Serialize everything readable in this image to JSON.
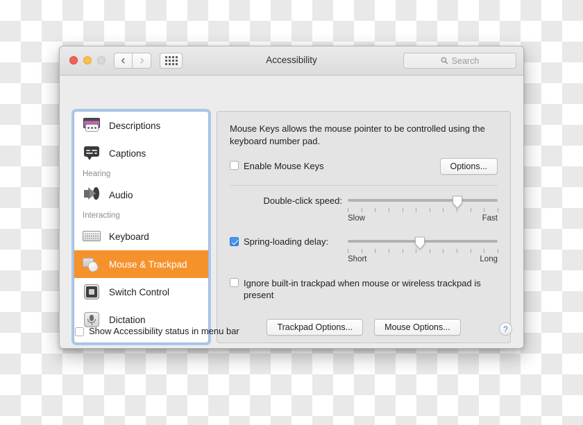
{
  "window": {
    "title": "Accessibility",
    "traffic_lights": [
      "close-red",
      "minimize-yellow",
      "zoom-green-disabled"
    ],
    "nav": {
      "back": "‹",
      "forward": "›"
    },
    "grid_button": "all-preferences-grid"
  },
  "search": {
    "placeholder": "Search",
    "value": ""
  },
  "sidebar": {
    "items": [
      {
        "type": "item",
        "label": "Descriptions",
        "icon": "descriptions-icon",
        "selected": false
      },
      {
        "type": "item",
        "label": "Captions",
        "icon": "captions-icon",
        "selected": false
      },
      {
        "type": "group",
        "label": "Hearing"
      },
      {
        "type": "item",
        "label": "Audio",
        "icon": "audio-icon",
        "selected": false
      },
      {
        "type": "group",
        "label": "Interacting"
      },
      {
        "type": "item",
        "label": "Keyboard",
        "icon": "keyboard-icon",
        "selected": false
      },
      {
        "type": "item",
        "label": "Mouse & Trackpad",
        "icon": "mouse-trackpad-icon",
        "selected": true
      },
      {
        "type": "item",
        "label": "Switch Control",
        "icon": "switch-control-icon",
        "selected": false
      },
      {
        "type": "item",
        "label": "Dictation",
        "icon": "dictation-icon",
        "selected": false
      }
    ],
    "selected_color": "#f5922b",
    "focus_ring_color": "#78aae6"
  },
  "main": {
    "description": "Mouse Keys allows the mouse pointer to be controlled using the keyboard number pad.",
    "enable_mouse_keys": {
      "label": "Enable Mouse Keys",
      "checked": false
    },
    "options_button": "Options...",
    "sliders": [
      {
        "label": "Double-click speed:",
        "has_checkbox": false,
        "checked": false,
        "value_percent": 73,
        "tick_count": 12,
        "low_label": "Slow",
        "high_label": "Fast"
      },
      {
        "label": "Spring-loading delay:",
        "has_checkbox": true,
        "checked": true,
        "value_percent": 48,
        "tick_count": 12,
        "low_label": "Short",
        "high_label": "Long"
      }
    ],
    "ignore_trackpad": {
      "label": "Ignore built-in trackpad when mouse or wireless trackpad is present",
      "checked": false
    },
    "buttons": [
      "Trackpad Options...",
      "Mouse Options..."
    ]
  },
  "bottom": {
    "show_status": {
      "label": "Show Accessibility status in menu bar",
      "checked": false
    },
    "help_button": "?"
  }
}
